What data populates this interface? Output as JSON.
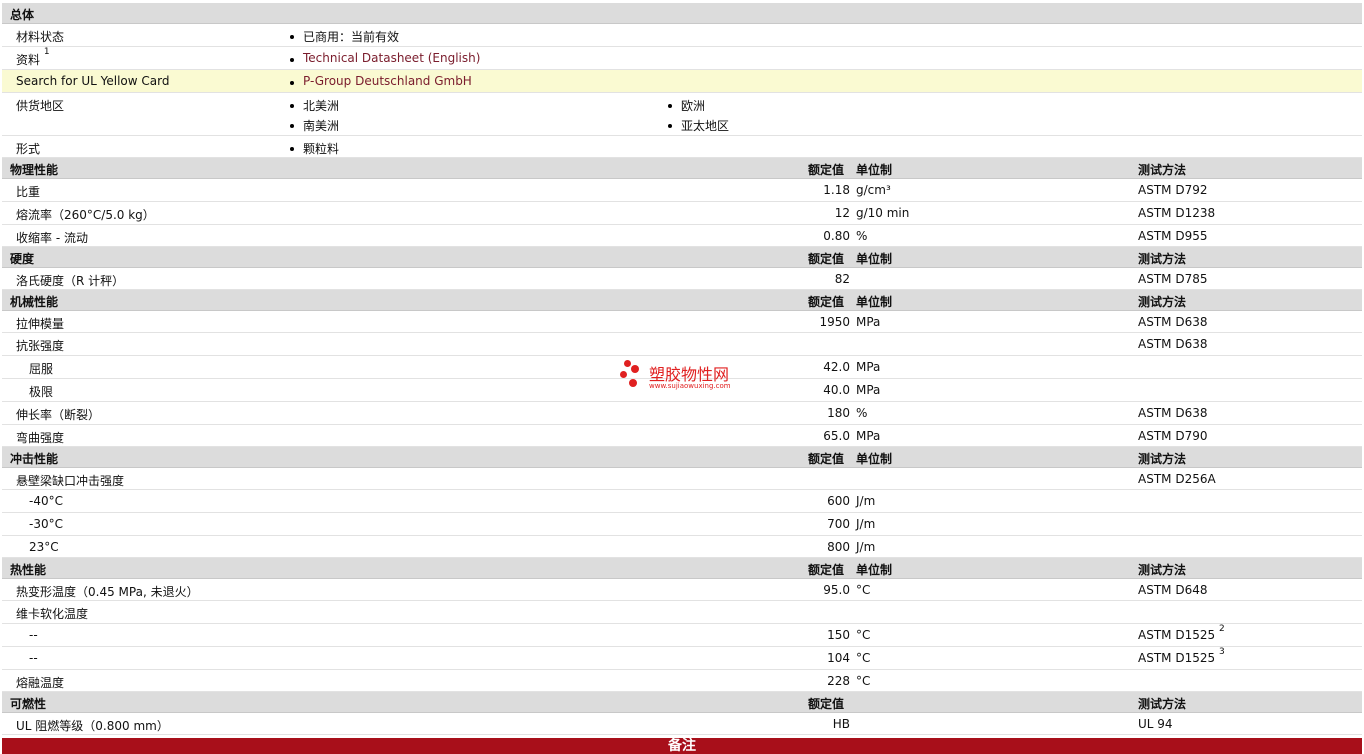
{
  "general": {
    "header": "总体",
    "material_status": {
      "label": "材料状态",
      "value": "已商用：当前有效"
    },
    "literature": {
      "label": "资料",
      "sup": "1",
      "link": "Technical Datasheet (English)"
    },
    "ul_card": {
      "label": "Search for UL Yellow Card",
      "link": "P-Group Deutschland GmbH"
    },
    "availability": {
      "label": "供货地区",
      "regions": [
        "北美洲",
        "欧洲",
        "南美洲",
        "亚太地区"
      ]
    },
    "form": {
      "label": "形式",
      "value": "颗粒料"
    }
  },
  "col_headers": {
    "nominal": "额定值",
    "unit": "单位制",
    "method": "测试方法"
  },
  "physical": {
    "header": "物理性能",
    "rows": [
      {
        "label": "比重",
        "value": "1.18",
        "unit": "g/cm³",
        "method": "ASTM D792"
      },
      {
        "label": "熔流率（260°C/5.0 kg）",
        "value": "12",
        "unit": "g/10 min",
        "method": "ASTM D1238"
      },
      {
        "label": "收缩率 - 流动",
        "value": "0.80",
        "unit": "%",
        "method": "ASTM D955"
      }
    ]
  },
  "hardness": {
    "header": "硬度",
    "rows": [
      {
        "label": "洛氏硬度（R 计秤）",
        "value": "82",
        "unit": "",
        "method": "ASTM D785"
      }
    ]
  },
  "mechanical": {
    "header": "机械性能",
    "tensile_modulus": {
      "label": "拉伸模量",
      "value": "1950",
      "unit": "MPa",
      "method": "ASTM D638"
    },
    "tensile_strength": {
      "label": "抗张强度",
      "method": "ASTM D638"
    },
    "yield": {
      "label": "屈服",
      "value": "42.0",
      "unit": "MPa"
    },
    "break": {
      "label": "极限",
      "value": "40.0",
      "unit": "MPa"
    },
    "elongation": {
      "label": "伸长率（断裂）",
      "value": "180",
      "unit": "%",
      "method": "ASTM D638"
    },
    "flex": {
      "label": "弯曲强度",
      "value": "65.0",
      "unit": "MPa",
      "method": "ASTM D790"
    }
  },
  "impact": {
    "header": "冲击性能",
    "izod": {
      "label": "悬壁梁缺口冲击强度",
      "method": "ASTM D256A"
    },
    "rows": [
      {
        "label": "-40°C",
        "value": "600",
        "unit": "J/m"
      },
      {
        "label": "-30°C",
        "value": "700",
        "unit": "J/m"
      },
      {
        "label": "23°C",
        "value": "800",
        "unit": "J/m"
      }
    ]
  },
  "thermal": {
    "header": "热性能",
    "hdt": {
      "label": "热变形温度（0.45 MPa, 未退火）",
      "value": "95.0",
      "unit": "°C",
      "method": "ASTM D648"
    },
    "vicat": {
      "label": "维卡软化温度"
    },
    "vicat_rows": [
      {
        "label": "--",
        "value": "150",
        "unit": "°C",
        "method": "ASTM D1525",
        "sup": "2"
      },
      {
        "label": "--",
        "value": "104",
        "unit": "°C",
        "method": "ASTM D1525",
        "sup": "3"
      }
    ],
    "melt": {
      "label": "熔融温度",
      "value": "228",
      "unit": "°C"
    }
  },
  "flammability": {
    "header": "可燃性",
    "rows": [
      {
        "label": "UL 阻燃等级（0.800 mm）",
        "value": "HB",
        "method": "UL 94"
      }
    ]
  },
  "footer": "备注",
  "watermark": {
    "text": "塑胶物性网",
    "url": "www.sujiaowuxing.com"
  },
  "colors": {
    "link": "#7a1c2c",
    "section_bg": "#dcdcdc",
    "highlight": "#fafad2",
    "footer_bg": "#a80f1a",
    "watermark": "#e02020"
  }
}
